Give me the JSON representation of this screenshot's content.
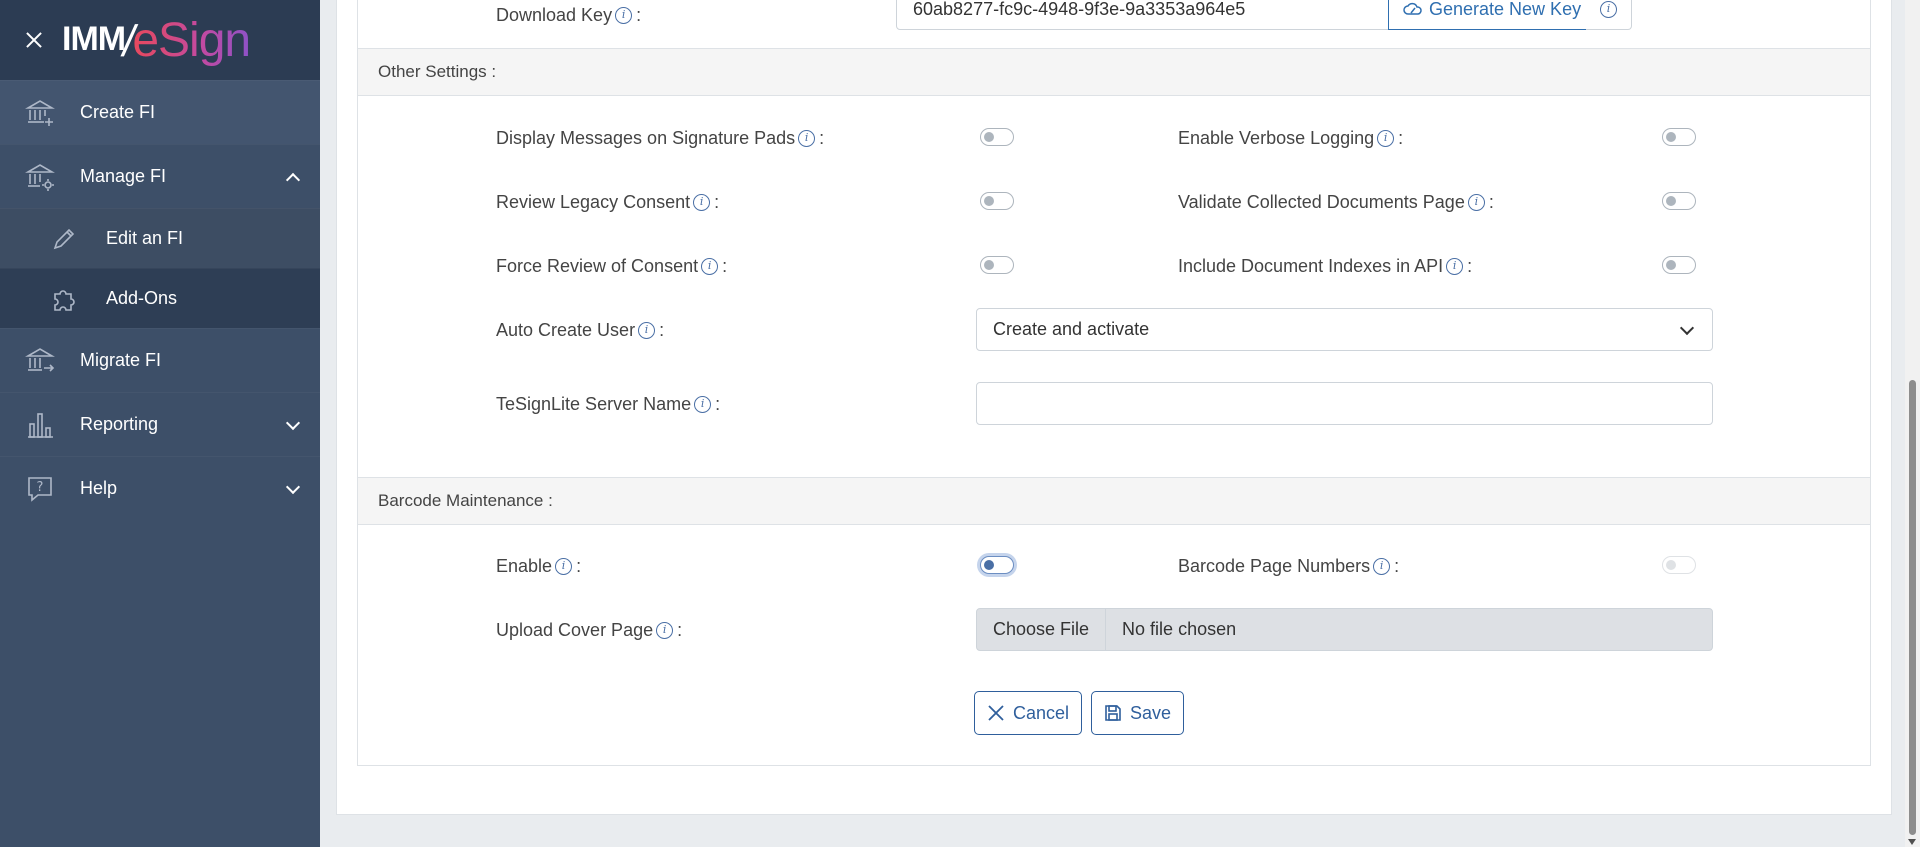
{
  "app": {
    "logo_left": "IMM",
    "logo_right": "eSign"
  },
  "sidebar": {
    "items": [
      {
        "label": "Create FI",
        "icon": "bank-plus-icon"
      },
      {
        "label": "Manage FI",
        "icon": "bank-gear-icon",
        "expanded": true
      },
      {
        "label": "Edit an FI",
        "icon": "pencil-icon",
        "sub": true
      },
      {
        "label": "Add-Ons",
        "icon": "puzzle-icon",
        "sub": true
      },
      {
        "label": "Migrate FI",
        "icon": "bank-arrow-icon"
      },
      {
        "label": "Reporting",
        "icon": "bar-chart-icon"
      },
      {
        "label": "Help",
        "icon": "help-bubble-icon"
      }
    ]
  },
  "download": {
    "label": "Download Key",
    "value": "60ab8277-fc9c-4948-9f3e-9a3353a964e5",
    "generate_label": "Generate New Key"
  },
  "other_settings": {
    "title": "Other Settings :",
    "display_messages": "Display Messages on Signature Pads",
    "verbose_logging": "Enable Verbose Logging",
    "review_legacy": "Review Legacy Consent",
    "validate_docs": "Validate Collected Documents Page",
    "force_review": "Force Review of Consent",
    "include_indexes": "Include Document Indexes in API",
    "auto_create_user": "Auto Create User",
    "auto_create_value": "Create and activate",
    "tesignlite_label": "TeSignLite Server Name",
    "tesignlite_value": ""
  },
  "barcode": {
    "title": "Barcode Maintenance :",
    "enable": "Enable",
    "page_numbers": "Barcode Page Numbers",
    "upload_cover": "Upload Cover Page",
    "choose_file": "Choose File",
    "no_file": "No file chosen"
  },
  "actions": {
    "cancel": "Cancel",
    "save": "Save"
  },
  "colors": {
    "sidebar": "#3d4f68",
    "accent": "#2f6fb0"
  }
}
